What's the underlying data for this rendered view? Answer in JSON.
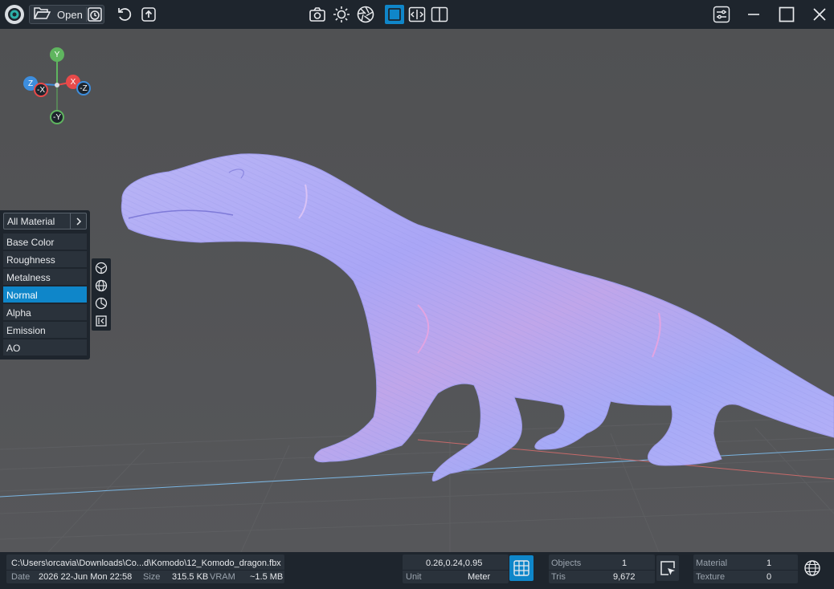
{
  "toolbar": {
    "open_label": "Open",
    "icons": [
      "app-logo-icon",
      "folder-open-icon",
      "history-icon",
      "reload-icon",
      "export-icon",
      "screenshot-icon",
      "light-icon",
      "aperture-icon",
      "single-view-icon",
      "split-compare-icon",
      "side-by-side-icon",
      "settings-icon",
      "minimize-icon",
      "maximize-icon",
      "close-icon"
    ]
  },
  "gizmo": {
    "y": "Y",
    "neg_y": "-Y",
    "x": "X",
    "neg_x": "-X",
    "z": "Z",
    "neg_z": "-Z",
    "colors": {
      "x": "#e84a4a",
      "y": "#5fb55f",
      "z": "#3d8ede"
    }
  },
  "material_panel": {
    "header": "All Material",
    "items": [
      "Base Color",
      "Roughness",
      "Metalness",
      "Normal",
      "Alpha",
      "Emission",
      "AO"
    ],
    "selected": "Normal",
    "side_tools": [
      "shader-ball-icon",
      "globe-icon",
      "pie-icon",
      "collapse-icon"
    ]
  },
  "status": {
    "path": "C:\\Users\\orcavia\\Downloads\\Co...d\\Komodo\\12_Komodo_dragon.fbx",
    "date_label": "Date",
    "date_value": "2026 22-Jun Mon 22:58",
    "size_label": "Size",
    "size_value": "315.5 KB",
    "vram_label": "VRAM",
    "vram_value": "~1.5 MB",
    "dimensions": "0.26,0.24,0.95",
    "unit_label": "Unit",
    "unit_value": "Meter",
    "objects_label": "Objects",
    "objects_value": "1",
    "tris_label": "Tris",
    "tris_value": "9,672",
    "material_label": "Material",
    "material_value": "1",
    "texture_label": "Texture",
    "texture_value": "0"
  },
  "colors": {
    "accent": "#0f86c9",
    "panel": "#1e252d",
    "viewport": "#505153",
    "model": "#a9a7f7"
  }
}
